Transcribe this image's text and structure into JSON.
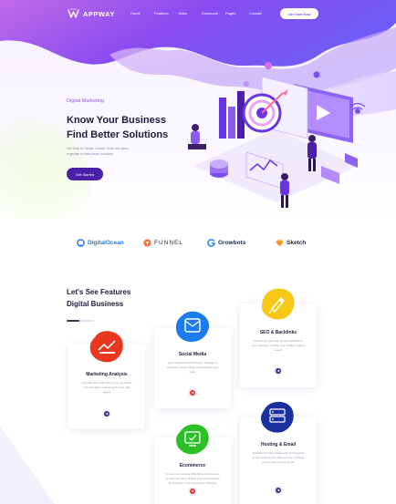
{
  "header": {
    "logo": "APPWAY",
    "nav": [
      "Home",
      "Features",
      "Video",
      "Download",
      "Pages",
      "Contact"
    ],
    "cta_label": "Get Start Now"
  },
  "hero": {
    "kicker": "Digital Marketing",
    "title_line1": "Know Your Business",
    "title_line2": "Find Better Solutions",
    "description": "Get Help for Ideals, Growth, Build and grow, expertise in data-driven solutions",
    "button_label": "Get Started"
  },
  "brands": [
    {
      "name": "DigitalOcean",
      "color": "#1f7bea",
      "icon": "digitalocean-icon"
    },
    {
      "name": "FUNNEL",
      "color": "#2b2b3c",
      "icon": "funnel-icon"
    },
    {
      "name": "Growbots",
      "color": "#1f2a44",
      "icon": "growbots-icon"
    },
    {
      "name": "Sketch",
      "color": "#2b2b3c",
      "icon": "sketch-icon"
    }
  ],
  "features": {
    "title_line1": "Let's See Features",
    "title_line2": "Digital Business",
    "cards": [
      {
        "title": "Marketing Analysis",
        "desc": "Increase web traffic with proper keywords and strengthen marketing for your own pages",
        "icon": "analysis-icon",
        "blob": "#e8361f",
        "arrow": "#3b2f6e"
      },
      {
        "title": "Social Media",
        "desc": "Get a business and followers, Engage in social get content ideas and audience spot today",
        "icon": "social-media-icon",
        "blob": "#1d7cf2",
        "arrow": "#e0372c"
      },
      {
        "title": "SEO & Backlinks",
        "desc": "Ensure you rank with quality backlinks to your website's visibility and credible organic search",
        "icon": "rocket-icon",
        "blob": "#f6c818",
        "arrow": "#3b2f6e"
      },
      {
        "title": "Ecommerce",
        "desc": "Grow your business ONLINE to Ecommerce to customer base. Selling improved products for business in the best online channels",
        "icon": "ecommerce-icon",
        "blob": "#2dbf27",
        "arrow": "#e0372c"
      },
      {
        "title": "Hosting & Email",
        "desc": "Reliable and fast hosting with professional grade email service. We can host, manage your domain names for you",
        "icon": "hosting-icon",
        "blob": "#1b2f9e",
        "arrow": "#3b2f6e"
      }
    ]
  }
}
